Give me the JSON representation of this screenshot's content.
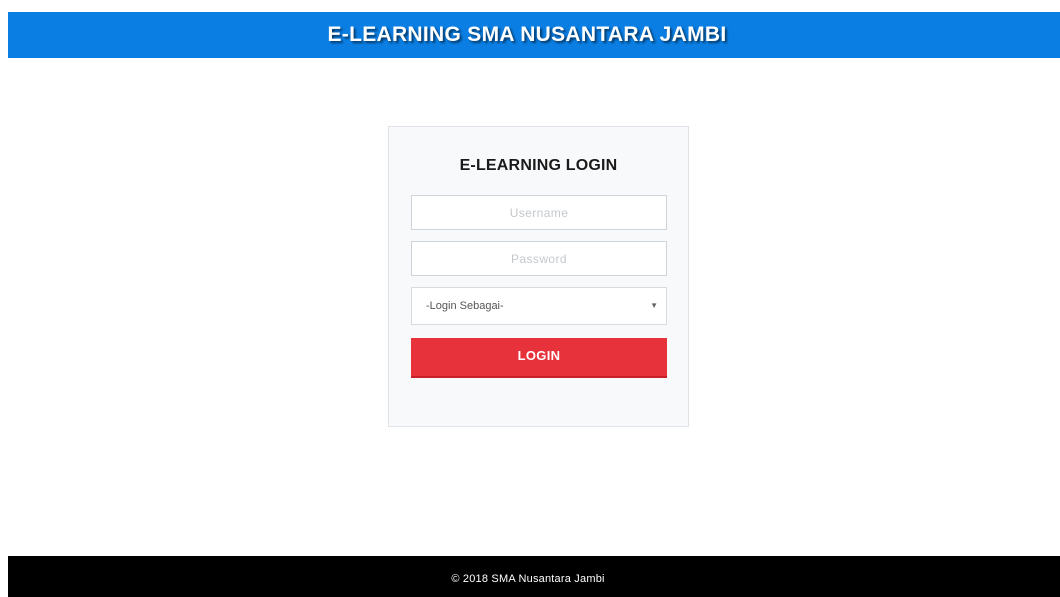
{
  "header": {
    "title": "E-LEARNING SMA NUSANTARA JAMBI",
    "background_color": "#0a7ee3"
  },
  "login": {
    "title": "E-LEARNING LOGIN",
    "username_placeholder": "Username",
    "password_placeholder": "Password",
    "role_select_value": "-Login Sebagai-",
    "role_select_arrow_icon": "triangle-down-icon",
    "submit_label": "LOGIN",
    "submit_color": "#e8323b"
  },
  "footer": {
    "text": "© 2018 SMA Nusantara Jambi",
    "background_color": "#000000"
  }
}
